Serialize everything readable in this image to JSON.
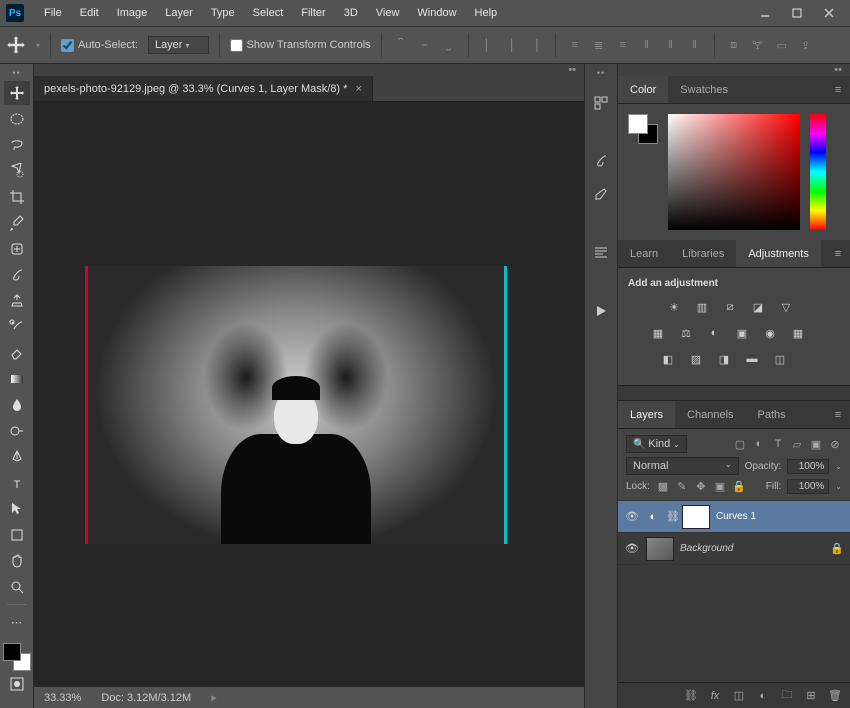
{
  "menu": [
    "File",
    "Edit",
    "Image",
    "Layer",
    "Type",
    "Select",
    "Filter",
    "3D",
    "View",
    "Window",
    "Help"
  ],
  "options": {
    "autoSelectLabel": "Auto-Select:",
    "autoSelectTarget": "Layer",
    "showTransform": "Show Transform Controls"
  },
  "document": {
    "tabTitle": "pexels-photo-92129.jpeg @ 33.3% (Curves 1, Layer Mask/8) *",
    "zoomStatus": "33.33%",
    "docInfo": "Doc: 3.12M/3.12M"
  },
  "panelTabs": {
    "color": "Color",
    "swatches": "Swatches",
    "learn": "Learn",
    "libraries": "Libraries",
    "adjustments": "Adjustments",
    "layers": "Layers",
    "channels": "Channels",
    "paths": "Paths"
  },
  "adjustments": {
    "heading": "Add an adjustment"
  },
  "layersPanel": {
    "filterKind": "Kind",
    "blendMode": "Normal",
    "opacityLabel": "Opacity:",
    "opacityValue": "100%",
    "lockLabel": "Lock:",
    "fillLabel": "Fill:",
    "fillValue": "100%",
    "layers": [
      {
        "name": "Curves 1",
        "selected": true,
        "locked": false,
        "adjustment": true
      },
      {
        "name": "Background",
        "selected": false,
        "locked": true,
        "adjustment": false
      }
    ]
  }
}
